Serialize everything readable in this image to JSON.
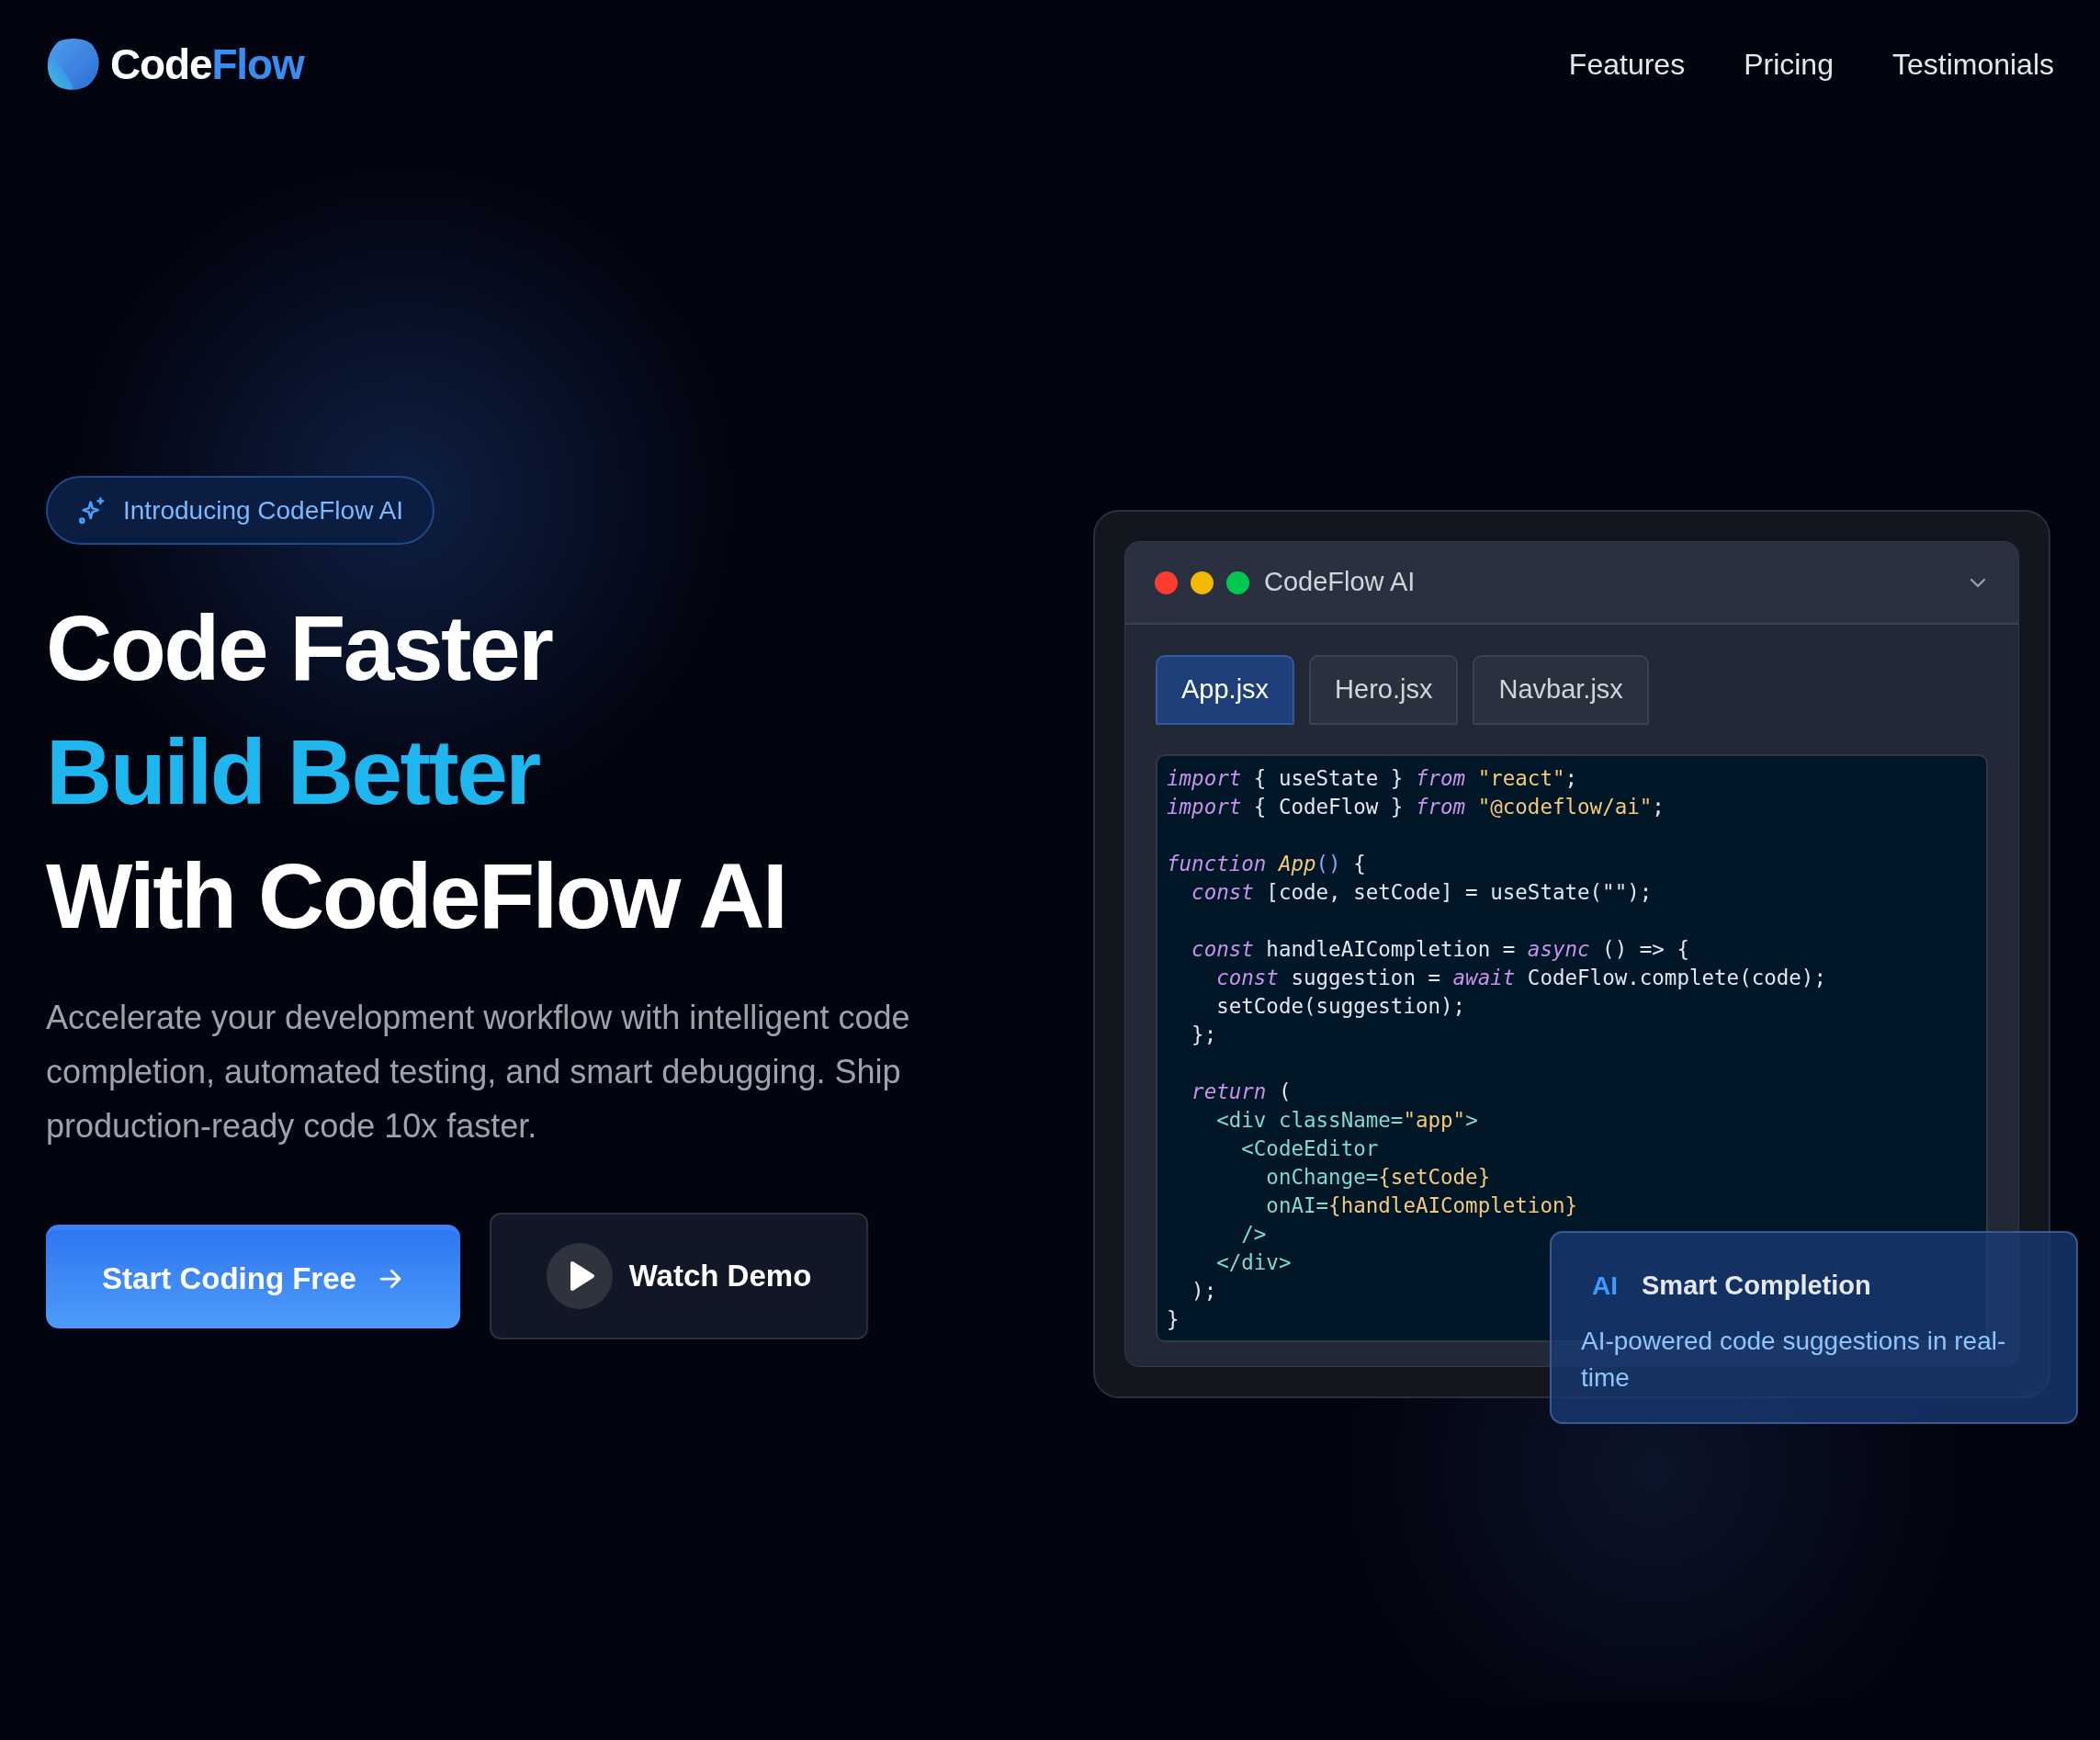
{
  "brand": {
    "part_1": "Code",
    "part_2": "Flow"
  },
  "nav": {
    "links": [
      "Features",
      "Pricing",
      "Testimonials"
    ]
  },
  "hero": {
    "badge": "Introducing CodeFlow AI",
    "headline": [
      {
        "text": "Code Faster",
        "kind": "plain"
      },
      {
        "text": "Build Better",
        "kind": "accent"
      },
      {
        "text": "With CodeFlow AI",
        "kind": "plain"
      }
    ],
    "description": "Accelerate your development workflow with intelligent code completion, automated testing, and smart debugging. Ship production-ready code 10x faster.",
    "buttons": [
      {
        "label": "Start Coding Free",
        "kind": "primary"
      },
      {
        "label": "Watch Demo",
        "kind": "secondary"
      }
    ]
  },
  "editor": {
    "title": "CodeFlow AI",
    "tabs": [
      {
        "label": "App.jsx",
        "selected": true
      },
      {
        "label": "Hero.jsx",
        "selected": false
      },
      {
        "label": "Navbar.jsx",
        "selected": false
      }
    ],
    "lines": [
      {
        "kind": "code",
        "tokens": [
          {
            "kind": "keyword",
            "text": "import"
          },
          {
            "kind": "plain",
            "text": " { useState } "
          },
          {
            "kind": "keyword",
            "text": "from "
          },
          {
            "kind": "string",
            "text": "\"react\""
          },
          {
            "kind": "plain",
            "text": ";"
          }
        ]
      },
      {
        "kind": "code",
        "tokens": [
          {
            "kind": "keyword",
            "text": "import"
          },
          {
            "kind": "plain",
            "text": " { CodeFlow } "
          },
          {
            "kind": "keyword",
            "text": "from "
          },
          {
            "kind": "string",
            "text": "\"@codeflow/ai\""
          },
          {
            "kind": "plain",
            "text": ";"
          }
        ]
      },
      {
        "kind": "blank"
      },
      {
        "kind": "code",
        "tokens": [
          {
            "kind": "keyword",
            "text": "function "
          },
          {
            "kind": "name",
            "text": "App"
          },
          {
            "kind": "paren",
            "text": "()"
          },
          {
            "kind": "plain",
            "text": " {"
          }
        ]
      },
      {
        "kind": "code",
        "tokens": [
          {
            "kind": "keyword",
            "text": "  const"
          },
          {
            "kind": "plain",
            "text": " [code, setCode] = useState(\"\");"
          }
        ]
      },
      {
        "kind": "blank"
      },
      {
        "kind": "code",
        "tokens": [
          {
            "kind": "keyword",
            "text": "  const"
          },
          {
            "kind": "plain",
            "text": " handleAICompletion = "
          },
          {
            "kind": "keyword",
            "text": "async"
          },
          {
            "kind": "plain",
            "text": " () => {"
          }
        ]
      },
      {
        "kind": "code",
        "tokens": [
          {
            "kind": "keyword",
            "text": "    const"
          },
          {
            "kind": "plain",
            "text": " suggestion = "
          },
          {
            "kind": "keyword",
            "text": "await"
          },
          {
            "kind": "plain",
            "text": " CodeFlow.complete(code);"
          }
        ]
      },
      {
        "kind": "code",
        "tokens": [
          {
            "kind": "plain",
            "text": "    setCode(suggestion);"
          }
        ]
      },
      {
        "kind": "code",
        "tokens": [
          {
            "kind": "plain",
            "text": "  };"
          }
        ]
      },
      {
        "kind": "blank"
      },
      {
        "kind": "code",
        "tokens": [
          {
            "kind": "keyword",
            "text": "  return"
          },
          {
            "kind": "plain",
            "text": " ("
          }
        ]
      },
      {
        "kind": "code",
        "tokens": [
          {
            "kind": "tag",
            "text": "    <div className="
          },
          {
            "kind": "string",
            "text": "\"app\""
          },
          {
            "kind": "tag",
            "text": ">"
          }
        ]
      },
      {
        "kind": "code",
        "tokens": [
          {
            "kind": "tag",
            "text": "      <CodeEditor"
          }
        ]
      },
      {
        "kind": "code",
        "tokens": [
          {
            "kind": "tag",
            "text": "        onChange="
          },
          {
            "kind": "string",
            "text": "{setCode}"
          }
        ]
      },
      {
        "kind": "code",
        "tokens": [
          {
            "kind": "tag",
            "text": "        onAI="
          },
          {
            "kind": "string",
            "text": "{handleAICompletion}"
          }
        ]
      },
      {
        "kind": "code",
        "tokens": [
          {
            "kind": "tag",
            "text": "      />"
          }
        ]
      },
      {
        "kind": "code",
        "tokens": [
          {
            "kind": "tag",
            "text": "    </div>"
          }
        ]
      },
      {
        "kind": "code",
        "tokens": [
          {
            "kind": "plain",
            "text": "  );"
          }
        ]
      },
      {
        "kind": "code",
        "tokens": [
          {
            "kind": "plain",
            "text": "}"
          }
        ]
      }
    ]
  },
  "feature_card": {
    "tag": "AI",
    "title": "Smart Completion",
    "description": "AI-powered code suggestions in real-time"
  }
}
